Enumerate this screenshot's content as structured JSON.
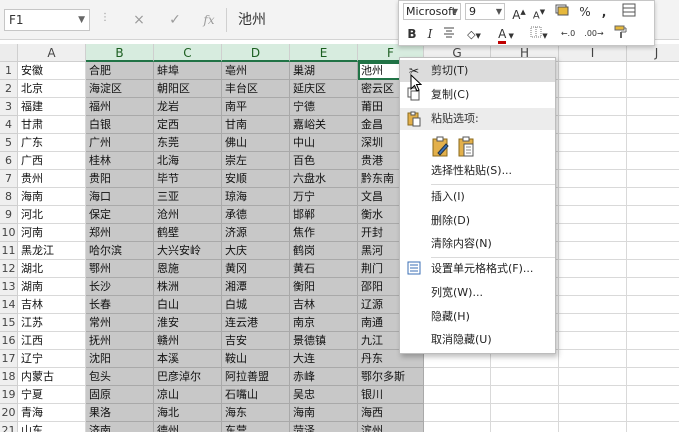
{
  "formula_bar": {
    "name_box": "F1",
    "formula_value": "池州",
    "cancel_glyph": "×",
    "enter_glyph": "✓",
    "fx_glyph": "fx"
  },
  "columns": [
    "A",
    "B",
    "C",
    "D",
    "E",
    "F",
    "G",
    "H",
    "I",
    "J"
  ],
  "rows": [
    [
      "安徽",
      "合肥",
      "蚌埠",
      "亳州",
      "巢湖",
      "池州"
    ],
    [
      "北京",
      "海淀区",
      "朝阳区",
      "丰台区",
      "延庆区",
      "密云区"
    ],
    [
      "福建",
      "福州",
      "龙岩",
      "南平",
      "宁德",
      "莆田"
    ],
    [
      "甘肃",
      "白银",
      "定西",
      "甘南",
      "嘉峪关",
      "金昌"
    ],
    [
      "广东",
      "广州",
      "东莞",
      "佛山",
      "中山",
      "深圳"
    ],
    [
      "广西",
      "桂林",
      "北海",
      "崇左",
      "百色",
      "贵港"
    ],
    [
      "贵州",
      "贵阳",
      "毕节",
      "安顺",
      "六盘水",
      "黔东南"
    ],
    [
      "海南",
      "海口",
      "三亚",
      "琼海",
      "万宁",
      "文昌"
    ],
    [
      "河北",
      "保定",
      "沧州",
      "承德",
      "邯郸",
      "衡水"
    ],
    [
      "河南",
      "郑州",
      "鹤壁",
      "济源",
      "焦作",
      "开封"
    ],
    [
      "黑龙江",
      "哈尔滨",
      "大兴安岭",
      "大庆",
      "鹤岗",
      "黑河"
    ],
    [
      "湖北",
      "鄂州",
      "恩施",
      "黄冈",
      "黄石",
      "荆门"
    ],
    [
      "湖南",
      "长沙",
      "株洲",
      "湘潭",
      "衡阳",
      "邵阳"
    ],
    [
      "吉林",
      "长春",
      "白山",
      "白城",
      "吉林",
      "辽源"
    ],
    [
      "江苏",
      "常州",
      "淮安",
      "连云港",
      "南京",
      "南通"
    ],
    [
      "江西",
      "抚州",
      "赣州",
      "吉安",
      "景德镇",
      "九江"
    ],
    [
      "辽宁",
      "沈阳",
      "本溪",
      "鞍山",
      "大连",
      "丹东"
    ],
    [
      "内蒙古",
      "包头",
      "巴彦淖尔",
      "阿拉善盟",
      "赤峰",
      "鄂尔多斯"
    ],
    [
      "宁夏",
      "固原",
      "凉山",
      "石嘴山",
      "吴忠",
      "银川"
    ],
    [
      "青海",
      "果洛",
      "海北",
      "海东",
      "海南",
      "海西"
    ],
    [
      "山东",
      "济南",
      "德州",
      "东营",
      "菏泽",
      "滨州"
    ]
  ],
  "mini_toolbar": {
    "font_name": "Microsoft",
    "font_size": "9",
    "grow_font": "A",
    "shrink_font": "A",
    "percent": "%",
    "comma": ",",
    "bold": "B",
    "italic": "I",
    "font_color": "A"
  },
  "context_menu": {
    "cut": "剪切(T)",
    "copy": "复制(C)",
    "paste_options": "粘贴选项:",
    "paste_special": "选择性粘贴(S)...",
    "insert": "插入(I)",
    "delete": "删除(D)",
    "clear": "清除内容(N)",
    "format_cells": "设置单元格格式(F)...",
    "column_width": "列宽(W)...",
    "hide": "隐藏(H)",
    "unhide": "取消隐藏(U)"
  },
  "colors": {
    "selection_header": "#d7ecdf",
    "selection_border": "#217346",
    "grey_fill": "#c8c8c8"
  }
}
